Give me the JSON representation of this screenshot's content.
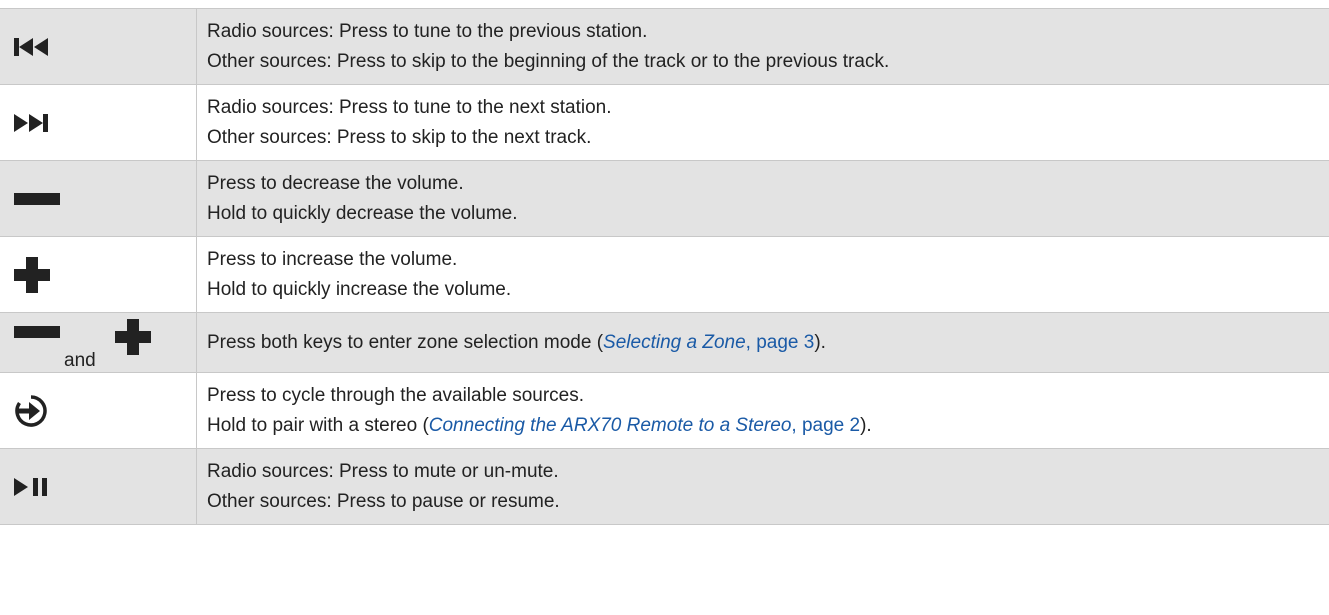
{
  "rows": [
    {
      "icon": "skip-previous-icon",
      "line1": "Radio sources: Press to tune to the previous station.",
      "line2": "Other sources: Press to skip to the beginning of the track or to the previous track."
    },
    {
      "icon": "skip-next-icon",
      "line1": "Radio sources: Press to tune to the next station.",
      "line2": "Other sources: Press to skip to the next track."
    },
    {
      "icon": "minus-icon",
      "line1": "Press to decrease the volume.",
      "line2": "Hold to quickly decrease the volume."
    },
    {
      "icon": "plus-icon",
      "line1": "Press to increase the volume.",
      "line2": "Hold to quickly increase the volume."
    },
    {
      "icon": "minus-and-plus-icons",
      "and_label": "and",
      "text_before": "Press both keys to enter zone selection mode (",
      "link_title": "Selecting a Zone",
      "link_page": ", page 3",
      "text_after": ")."
    },
    {
      "icon": "source-input-icon",
      "line1": "Press to cycle through the available sources.",
      "line2_before": "Hold to pair with a stereo (",
      "link_title": "Connecting the ARX70 Remote to a Stereo",
      "link_page": ", page 2",
      "line2_after": ")."
    },
    {
      "icon": "play-pause-icon",
      "line1": "Radio sources: Press to mute or un-mute.",
      "line2": "Other sources: Press to pause or resume."
    }
  ],
  "colors": {
    "shaded_row": "#e3e3e3",
    "link": "#1a5aa6",
    "border": "#c8c8c8"
  }
}
